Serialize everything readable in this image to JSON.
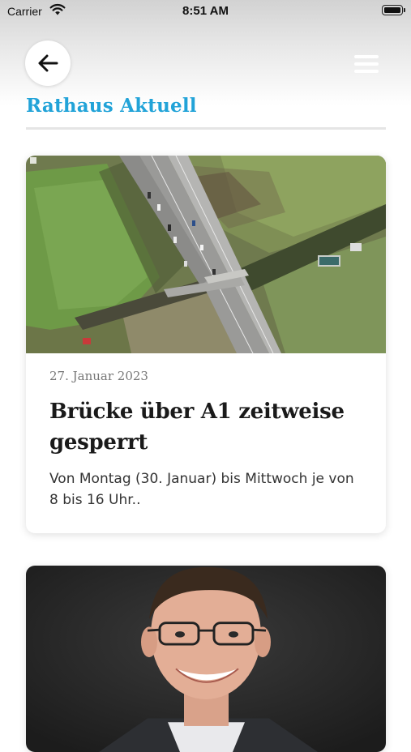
{
  "status_bar": {
    "carrier": "Carrier",
    "time": "8:51 AM"
  },
  "header": {
    "back_icon": "arrow-left-icon",
    "menu_icon": "hamburger-menu-icon",
    "section_title": "Rathaus Aktuell"
  },
  "colors": {
    "accent": "#22a3d8",
    "title_text": "#1a1a1a",
    "date_text": "#777777"
  },
  "articles": [
    {
      "image": "aerial-highway-bridge-photo",
      "date": "27. Januar 2023",
      "title": "Brücke über A1 zeitweise gesperrt",
      "excerpt": "Von Montag (30. Januar) bis Mittwoch je von 8 bis 16 Uhr.."
    },
    {
      "image": "portrait-photo-man-glasses"
    }
  ]
}
